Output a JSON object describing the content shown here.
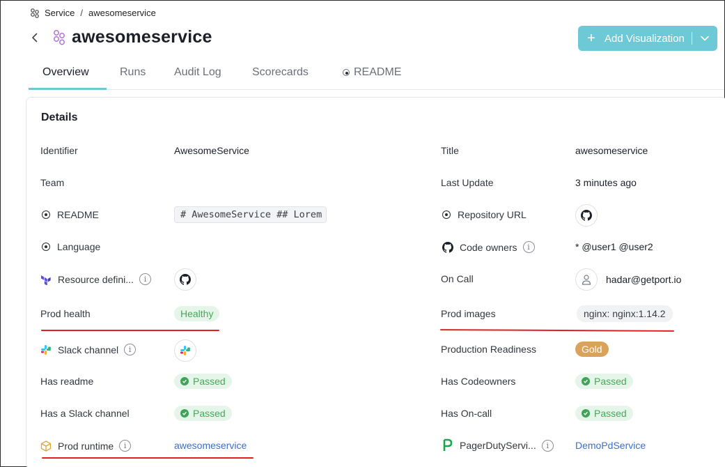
{
  "breadcrumb": {
    "parent": "Service",
    "separator": "/",
    "current": "awesomeservice"
  },
  "header": {
    "title": "awesomeservice",
    "add_button_label": "Add Visualization"
  },
  "tabs": [
    {
      "label": "Overview"
    },
    {
      "label": "Runs"
    },
    {
      "label": "Audit Log"
    },
    {
      "label": "Scorecards"
    },
    {
      "label": "README"
    }
  ],
  "details": {
    "title": "Details",
    "left": {
      "identifier": {
        "label": "Identifier",
        "value": "AwesomeService"
      },
      "team": {
        "label": "Team",
        "value": ""
      },
      "readme": {
        "label": "README",
        "value": "# AwesomeService ## Lorem"
      },
      "language": {
        "label": "Language",
        "value": ""
      },
      "resource": {
        "label": "Resource defini..."
      },
      "prod_health": {
        "label": "Prod health",
        "value": "Healthy"
      },
      "slack": {
        "label": "Slack channel"
      },
      "has_readme": {
        "label": "Has readme",
        "value": "Passed"
      },
      "has_slack": {
        "label": "Has a Slack channel",
        "value": "Passed"
      },
      "prod_runtime": {
        "label": "Prod runtime",
        "value": "awesomeservice"
      }
    },
    "right": {
      "title": {
        "label": "Title",
        "value": "awesomeservice"
      },
      "last_update": {
        "label": "Last Update",
        "value": "3 minutes ago"
      },
      "repo_url": {
        "label": "Repository URL"
      },
      "code_owners": {
        "label": "Code owners",
        "value": "* @user1 @user2"
      },
      "on_call": {
        "label": "On Call",
        "value": "hadar@getport.io"
      },
      "prod_images": {
        "label": "Prod images",
        "value": "nginx: nginx:1.14.2"
      },
      "production_readiness": {
        "label": "Production Readiness",
        "value": "Gold"
      },
      "has_codeowners": {
        "label": "Has Codeowners",
        "value": "Passed"
      },
      "has_oncall": {
        "label": "Has On-call",
        "value": "Passed"
      },
      "pagerduty": {
        "label": "PagerDutyServi...",
        "value": "DemoPdService"
      }
    }
  },
  "colors": {
    "accent": "#6ec9d6",
    "passed_bg": "#e6f5e9",
    "passed_text": "#47a85a",
    "gold": "#dba35a",
    "link": "#3b6ed3",
    "annotation": "#e02020"
  },
  "icons": [
    "blueprint-icon",
    "chevron-left-icon",
    "plus-icon",
    "chevron-down-icon",
    "target-icon",
    "github-icon",
    "terraform-icon",
    "slack-icon",
    "info-icon",
    "user-icon",
    "check-icon",
    "box-icon",
    "pagerduty-icon"
  ]
}
